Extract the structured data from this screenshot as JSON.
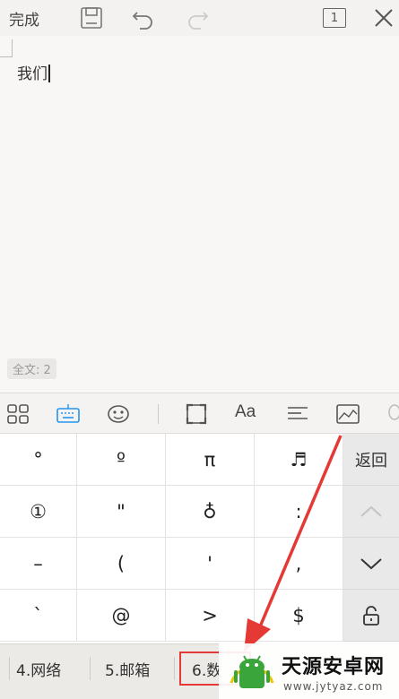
{
  "toolbar": {
    "done_label": "完成",
    "icons": [
      "save-icon",
      "undo-icon",
      "redo-icon",
      "page-count-icon",
      "close-icon"
    ],
    "page_badge": "1"
  },
  "document": {
    "text": "我们",
    "word_count": "全文: 2"
  },
  "format_toolbar": {
    "icons": [
      "grid-icon",
      "keyboard-icon",
      "emoji-icon",
      "fullscreen-icon",
      "font-icon",
      "align-icon",
      "image-icon",
      "voice-icon"
    ],
    "font_label": "Aa",
    "active": "keyboard-icon"
  },
  "keyboard": {
    "rows": [
      [
        "°",
        "º",
        "π",
        "♬"
      ],
      [
        "①",
        "\"",
        "♁",
        ":"
      ],
      [
        "–",
        "(",
        "'",
        ","
      ],
      [
        "`",
        "@",
        ">",
        "$"
      ]
    ],
    "side": {
      "back_label": "返回",
      "up_icon": "chevron-up-icon",
      "down_icon": "chevron-down-icon",
      "lock_icon": "lock-icon"
    }
  },
  "categories": {
    "items": [
      "4.网络",
      "5.邮箱",
      "6.数"
    ],
    "selected_index": 2
  },
  "watermark": {
    "site_name": "天源安卓网",
    "url": "www.jytyaz.com"
  },
  "colors": {
    "accent": "#2196f3",
    "highlight_red": "#e53935",
    "watermark_green": "#3aa53a"
  }
}
